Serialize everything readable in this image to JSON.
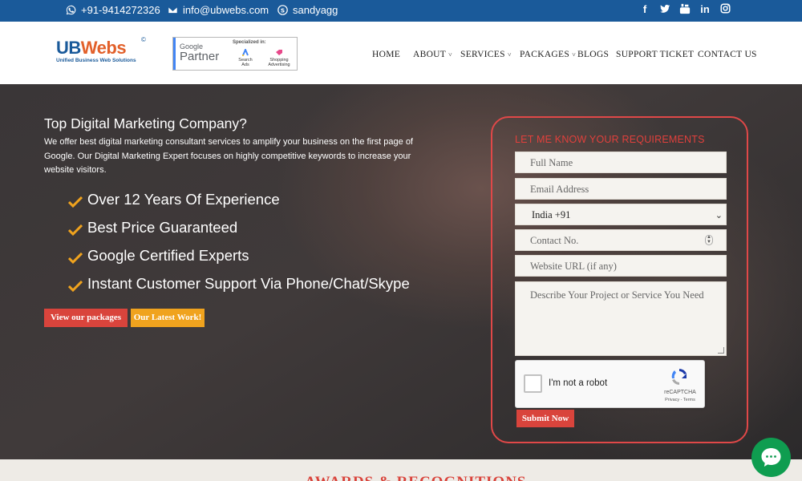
{
  "topbar": {
    "phone": "+91-9414272326",
    "email": "info@ubwebs.com",
    "skype": "sandyagg",
    "social_icons": [
      "facebook-icon",
      "twitter-icon",
      "youtube-icon",
      "linkedin-icon",
      "instagram-icon"
    ],
    "bg_color": "#1a5a9a"
  },
  "header": {
    "logo_main_1": "UB",
    "logo_main_2": "Webs",
    "logo_tagline": "Unified Business Web Solutions",
    "partner": {
      "google": "Google",
      "partner": "Partner",
      "specialized": "Specialized in:",
      "search_ads": "Search Ads",
      "shopping": "Shopping Advertising"
    },
    "nav": {
      "home": "HOME",
      "about": "ABOUT",
      "services": "SERVICES",
      "packages": "PACKAGES",
      "blogs": "BLOGS",
      "support": "SUPPORT TICKET",
      "contact": "CONTACT US"
    }
  },
  "hero": {
    "title": "Top Digital Marketing Company?",
    "description": "We offer best digital marketing consultant services to amplify your business on the first page of Google. Our Digital Marketing Expert focuses on highly competitive keywords to increase your website visitors.",
    "features": [
      "Over 12 Years Of Experience",
      "Best Price Guaranteed",
      "Google Certified Experts",
      "Instant Customer Support Via Phone/Chat/Skype"
    ],
    "btn_packages": "View our packages",
    "btn_work": "Our Latest Work!",
    "accent_red": "#d9443c",
    "accent_orange": "#f0a31e"
  },
  "form": {
    "title": "LET ME KNOW YOUR REQUIREMENTS",
    "full_name_placeholder": "Full Name",
    "email_placeholder": "Email Address",
    "country_selected": "India +91",
    "contact_placeholder": "Contact No.",
    "website_placeholder": "Website URL (if any)",
    "project_placeholder": "Describe Your Project or Service You Need",
    "captcha_label": "I'm not a robot",
    "captcha_brand": "reCAPTCHA",
    "captcha_privacy": "Privacy - Terms",
    "submit": "Submit Now"
  },
  "bottom": {
    "section_title": "AWARDS & RECOGNITIONS"
  }
}
